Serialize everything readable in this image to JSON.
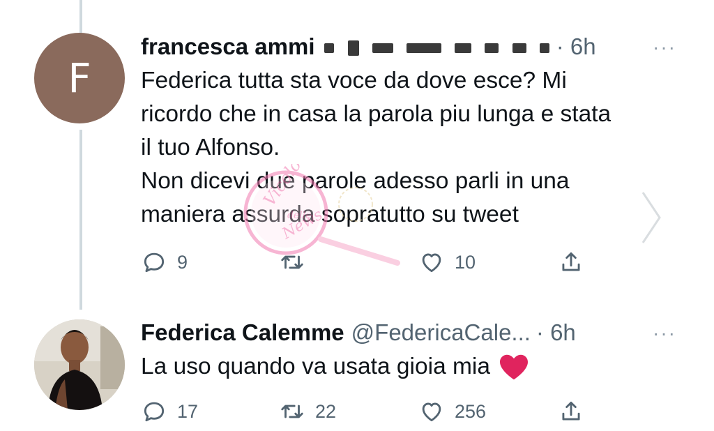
{
  "tweets": [
    {
      "author_name": "francesca ammi",
      "avatar_letter": "F",
      "time": "· 6h",
      "more": "···",
      "text": "Federica tutta sta voce da dove esce? Mi\nricordo che in casa la parola piu lunga e stata\nil tuo Alfonso.\nNon dicevi due parole adesso parli in una\nmaniera assurda sopratutto su tweet",
      "reply_count": "9",
      "retweet_count": "",
      "like_count": "10"
    },
    {
      "author_name": "Federica Calemme",
      "handle": "@FedericaCale...",
      "time": "· 6h",
      "more": "···",
      "text": "La uso quando va usata gioia mia",
      "emoji": "❤️",
      "reply_count": "17",
      "retweet_count": "22",
      "like_count": "256"
    }
  ],
  "watermark": {
    "text_line1": "Vicolo",
    "text_line2": "delle",
    "text_line3": "News"
  },
  "colors": {
    "text": "#0f1419",
    "muted": "#536471",
    "avatar_bg": "#8a6a5c",
    "heart": "#e0245e"
  }
}
